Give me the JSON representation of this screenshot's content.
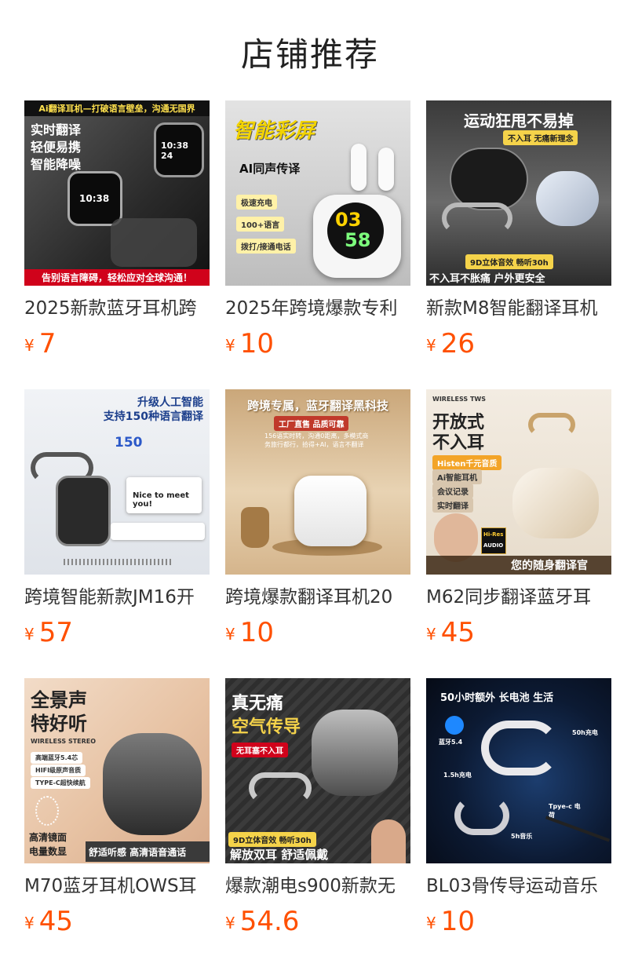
{
  "page": {
    "title": "店铺推荐"
  },
  "colors": {
    "price": "#ff5000",
    "text": "#333333"
  },
  "products": [
    {
      "name": "2025新款蓝牙耳机跨",
      "currency": "¥",
      "price": "7",
      "image": {
        "top_banner": "Ai翻译耳机—打破语言壁垒，沟通无国界",
        "line1": "实时翻译",
        "line2": "轻便易携",
        "line3": "智能降噪",
        "clock1": "10:38 24",
        "clock2": "10:38",
        "bottom_banner": "告别语言障碍，轻松应对全球沟通！"
      }
    },
    {
      "name": "2025年跨境爆款专利",
      "currency": "¥",
      "price": "10",
      "image": {
        "headline": "智能彩屏",
        "subtitle": "AI同声传译",
        "tag1": "极速充电",
        "tag2": "100+语言",
        "tag3": "拨打/接通电话",
        "screen_top": "03",
        "screen_bottom": "58"
      }
    },
    {
      "name": "新款M8智能翻译耳机",
      "currency": "¥",
      "price": "26",
      "image": {
        "headline": "运动狂甩不易掉",
        "tag": "不入耳 无痛新理念",
        "badge": "9D立体音效 畅听30h",
        "bottom_text": "不入耳不胀痛 户外更安全"
      }
    },
    {
      "name": "跨境智能新款JM16开",
      "currency": "¥",
      "price": "57",
      "image": {
        "headline1": "升级人工智能",
        "headline2": "支持150种语言翻译",
        "count": "150",
        "bubble": "Nice to meet you!"
      }
    },
    {
      "name": "跨境爆款翻译耳机20",
      "currency": "¥",
      "price": "10",
      "image": {
        "headline": "跨境专属，蓝牙翻译黑科技",
        "tag": "工厂直售 品质可靠",
        "desc": "156语实时转，沟通0距离，多模式商务旅行都行，拾得+AI，语言不翻译"
      }
    },
    {
      "name": "M62同步翻译蓝牙耳",
      "currency": "¥",
      "price": "45",
      "image": {
        "small": "WIRELESS TWS",
        "headline1": "开放式",
        "headline2": "不入耳",
        "tag1": "Histen千元音质",
        "tag2": "Ai智能耳机",
        "tag3": "会议记录",
        "tag4": "实时翻译",
        "badge1": "Hi-Res",
        "badge2": "AUDIO",
        "bottom_text": "您的随身翻译官"
      }
    },
    {
      "name": "M70蓝牙耳机OWS耳",
      "currency": "¥",
      "price": "45",
      "image": {
        "headline1": "全景声",
        "headline2": "特好听",
        "small": "WIRELESS STEREO",
        "tag1": "高端蓝牙5.4芯",
        "tag2": "HIFI级原声音质",
        "tag3": "TYPE-C超快续航",
        "side1": "高清镜面",
        "side2": "电量数显",
        "bottom_text": "舒适听感 高清语音通话"
      }
    },
    {
      "name": "爆款潮电s900新款无",
      "currency": "¥",
      "price": "54.6",
      "image": {
        "headline1": "真无痛",
        "headline2": "空气传导",
        "tag": "无耳塞不入耳",
        "badge": "9D立体音效 畅听30h",
        "bottom_text": "解放双耳 舒适佩戴"
      }
    },
    {
      "name": "BL03骨传导运动音乐",
      "currency": "¥",
      "price": "10",
      "image": {
        "top_text": "50小时额外 长电池 生活",
        "bt": "蓝牙5.4",
        "c1": "50h充电",
        "c2": "1.5h充电",
        "c3": "Tpye-c 电荷",
        "c4": "5h音乐"
      }
    }
  ]
}
